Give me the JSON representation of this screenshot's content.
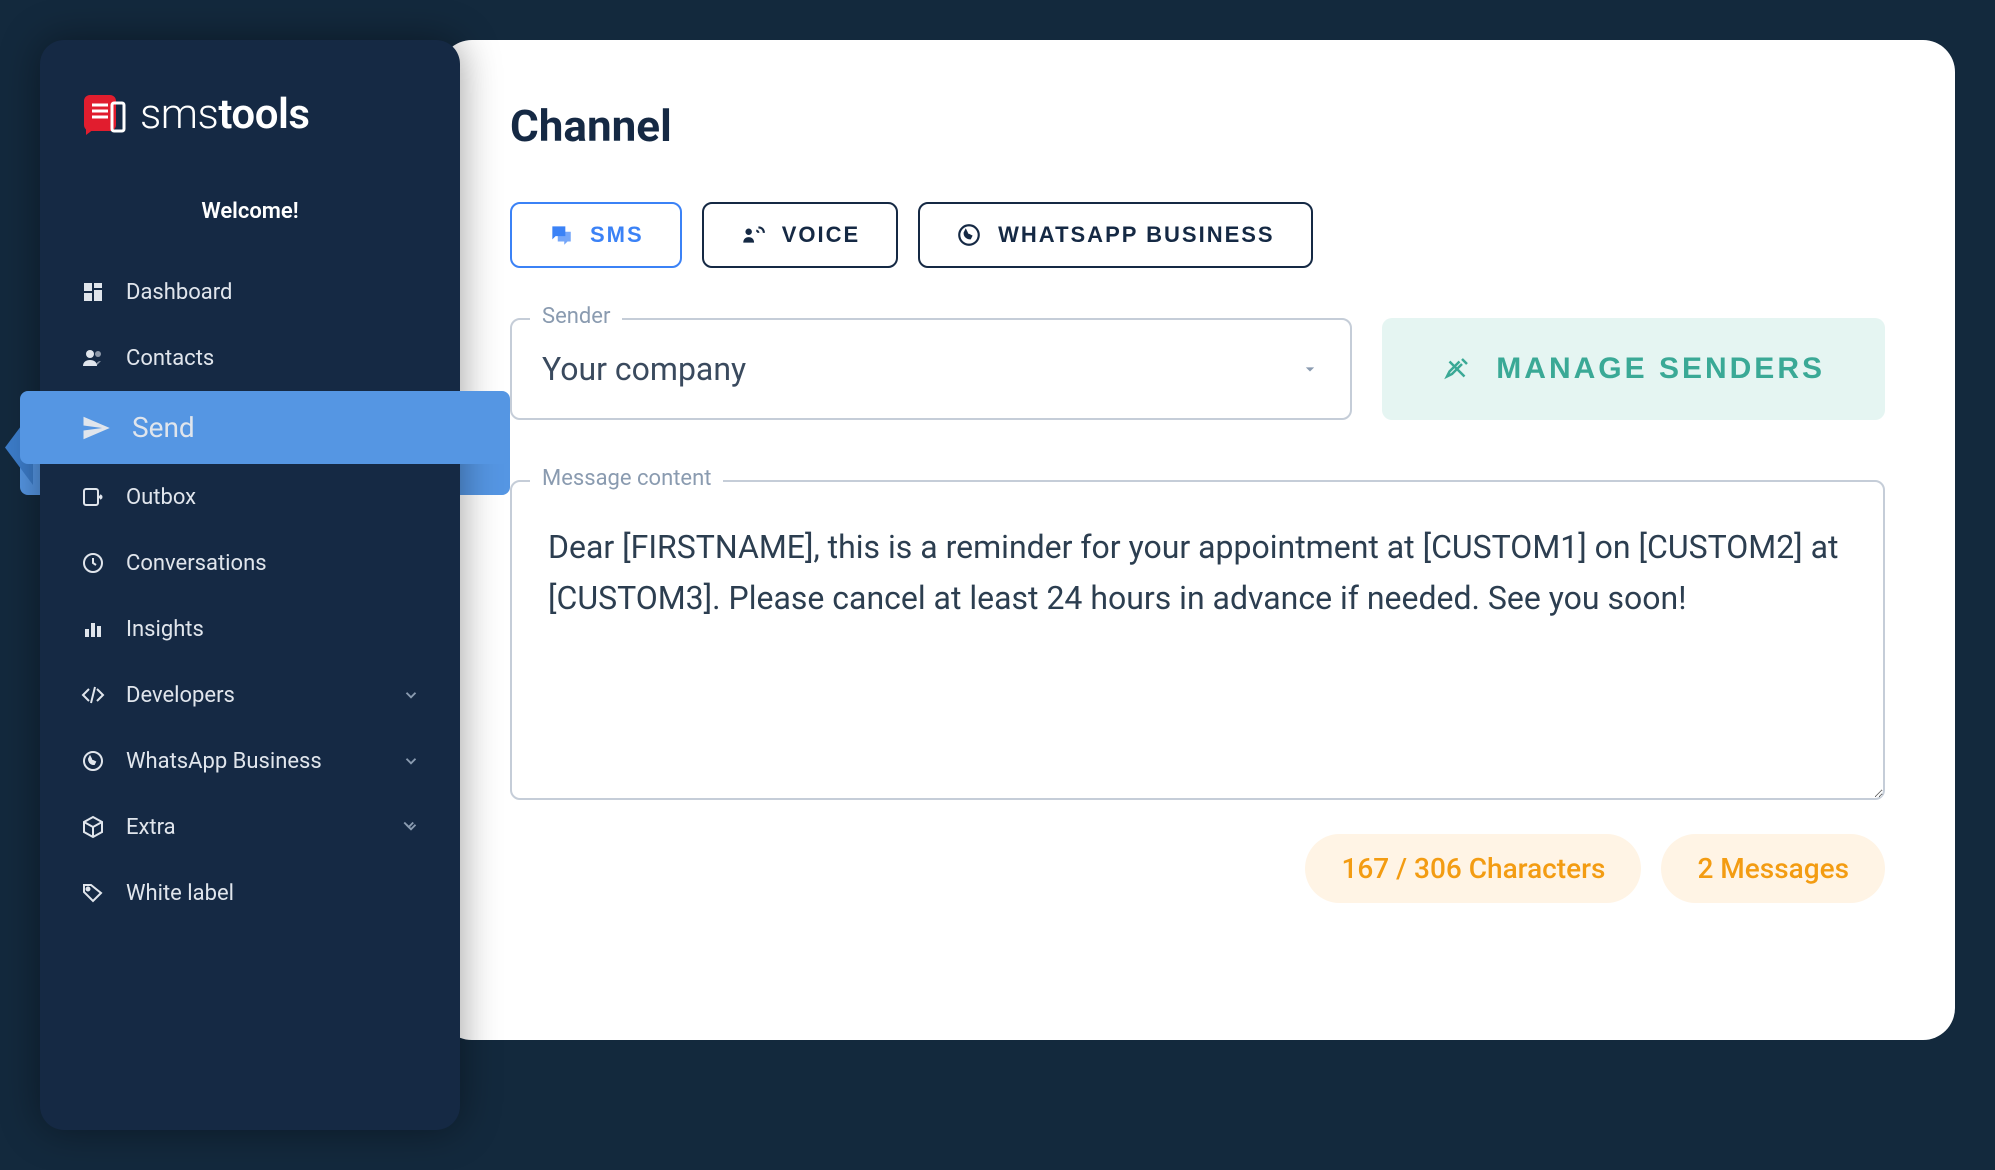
{
  "sidebar": {
    "logo_text_light": "sms",
    "logo_text_bold": "tools",
    "welcome": "Welcome!",
    "items": [
      {
        "label": "Dashboard",
        "icon": "dashboard"
      },
      {
        "label": "Contacts",
        "icon": "contacts"
      },
      {
        "label": "Send",
        "icon": "send",
        "active": true
      },
      {
        "label": "Outbox",
        "icon": "outbox"
      },
      {
        "label": "Conversations",
        "icon": "history"
      },
      {
        "label": "Insights",
        "icon": "insights"
      },
      {
        "label": "Developers",
        "icon": "developers",
        "expandable": true
      },
      {
        "label": "WhatsApp Business",
        "icon": "whatsapp",
        "expandable": true
      },
      {
        "label": "Extra",
        "icon": "box",
        "expandable": true
      },
      {
        "label": "White label",
        "icon": "whitelabel"
      }
    ]
  },
  "main": {
    "title": "Channel",
    "tabs": [
      {
        "label": "SMS",
        "icon": "chat",
        "active": true
      },
      {
        "label": "VOICE",
        "icon": "voice"
      },
      {
        "label": "WHATSAPP BUSINESS",
        "icon": "whatsapp"
      }
    ],
    "sender": {
      "label": "Sender",
      "value": "Your company"
    },
    "manage_senders": "MANAGE SENDERS",
    "message": {
      "label": "Message content",
      "value": "Dear [FIRSTNAME], this is a reminder for your appointment at [CUSTOM1] on [CUSTOM2] at [CUSTOM3]. Please cancel at least 24 hours in advance if needed. See you soon!"
    },
    "stats": {
      "characters": "167 / 306 Characters",
      "messages": "2 Messages"
    }
  }
}
